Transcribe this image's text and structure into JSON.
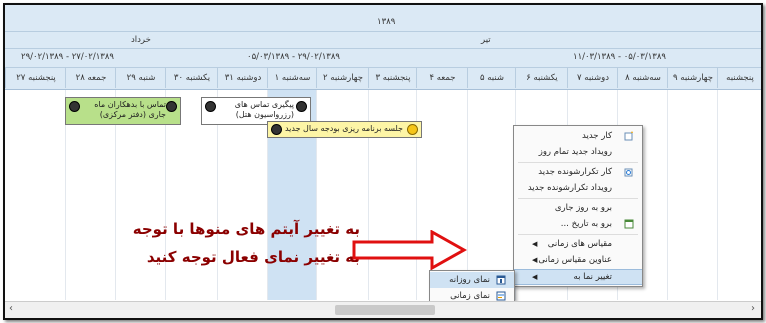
{
  "header": {
    "year": "۱۳۸۹",
    "month_left": "خرداد",
    "month_right": "تیر",
    "weeks": [
      "۲۹/۰۲/۱۳۸۹ - ۲۷/۰۲/۱۳۸۹",
      "۰۵/۰۳/۱۳۸۹ - ۲۹/۰۲/۱۳۸۹",
      "۱۱/۰۳/۱۳۸۹ - ۰۵/۰۳/۱۳۸۹"
    ],
    "days": [
      "۲۷ پنجشنبه",
      "۲۸ جمعه",
      "۲۹ شنبه",
      "۳۰ یکشنبه",
      "۳۱ دوشنبه",
      "۱ سه‌شنبه",
      "۲ چهارشنبه",
      "۳ پنجشنبه",
      "۴ جمعه",
      "۵ شنبه",
      "۶ یکشنبه",
      "۷ دوشنبه",
      "۸ سه‌شنبه",
      "۹ چهارشنبه",
      "پنجشنبه"
    ]
  },
  "appointments": [
    {
      "line1": "تماس با بدهکاران ماه",
      "line2": "جاری (دفتر مرکزی)"
    },
    {
      "line1": "پیگیری تماس های",
      "line2": "(رزرواسیون هتل)"
    },
    {
      "line1": "جلسه برنامه ریزی بودجه سال جدید",
      "line2": ""
    }
  ],
  "context_menu": {
    "items": [
      {
        "label": "کار جدید",
        "icon": "new-task-icon"
      },
      {
        "label": "رویداد جدید تمام روز",
        "icon": ""
      },
      {
        "label": "کار تکرارشونده جدید",
        "icon": "recurring-task-icon"
      },
      {
        "label": "رویداد تکرارشونده جدید",
        "icon": ""
      },
      {
        "label": "برو به روز جاری",
        "icon": ""
      },
      {
        "label": "برو به تاریخ ...",
        "icon": "goto-date-icon"
      },
      {
        "label": "مقیاس های زمانی",
        "icon": ""
      },
      {
        "label": "عناوین مقیاس زمانی",
        "icon": ""
      },
      {
        "label": "تغییر نما به",
        "icon": ""
      }
    ]
  },
  "submenu": {
    "items": [
      {
        "label": "نمای روزانه",
        "icon": "day-view-icon"
      },
      {
        "label": "نمای زمانی",
        "icon": "timeline-view-icon"
      }
    ]
  },
  "callout": {
    "line1": "به تغییر آیتم های منوها با توجه",
    "line2": "به تغییر نمای فعال توجه کنید"
  },
  "colors": {
    "header_bg": "#dbe9f5",
    "today_column": "#cfe2f3",
    "appt_green": "#b8e08a",
    "appt_white": "#ffffff",
    "appt_yellow": "#fdf5a6",
    "callout_text": "#8b0000",
    "arrow": "#e01010"
  }
}
